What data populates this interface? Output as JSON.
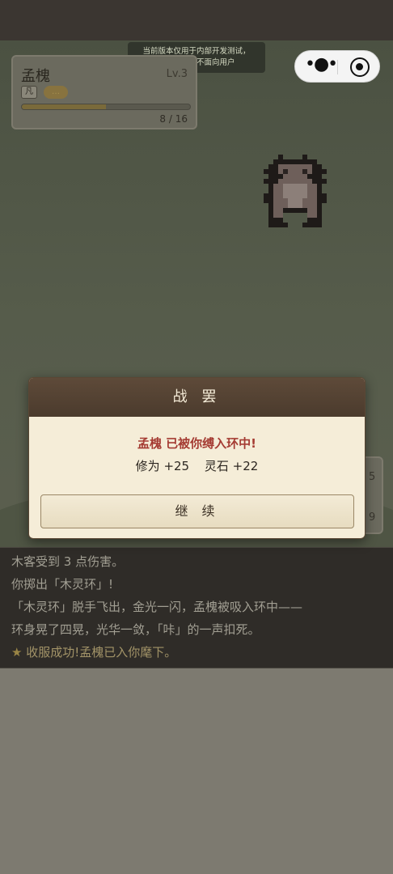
{
  "dev_notice": [
    "当前版本仅用于内部开发测试，",
    "所有内容均不面向用户"
  ],
  "enemy": {
    "name": "孟槐",
    "level": "Lv.3",
    "rank": "凡",
    "trait": "…",
    "hp_text": "8 / 16",
    "hp_fraction": 0.5
  },
  "side_card": {
    "top_value": "5",
    "bottom_value": "9"
  },
  "modal": {
    "title": "战 罢",
    "message": "孟槐 已被你缚入环中!",
    "rewards": [
      "修为 +25",
      "灵石 +22"
    ],
    "continue_label": "继 续"
  },
  "log": [
    "木客受到 3 点伤害。",
    "你掷出「木灵环」!",
    "「木灵环」脱手飞出，金光一闪，孟槐被吸入环中——",
    "环身晃了四晃，光华一敛，「咔」的一声扣死。"
  ],
  "log_success": {
    "star": "★",
    "text": "收服成功!孟槐已入你麾下。"
  },
  "colors": {
    "accent_red": "#a53c33",
    "modal_header": "#4b3b2d",
    "log_bg": "#2f2c28"
  }
}
